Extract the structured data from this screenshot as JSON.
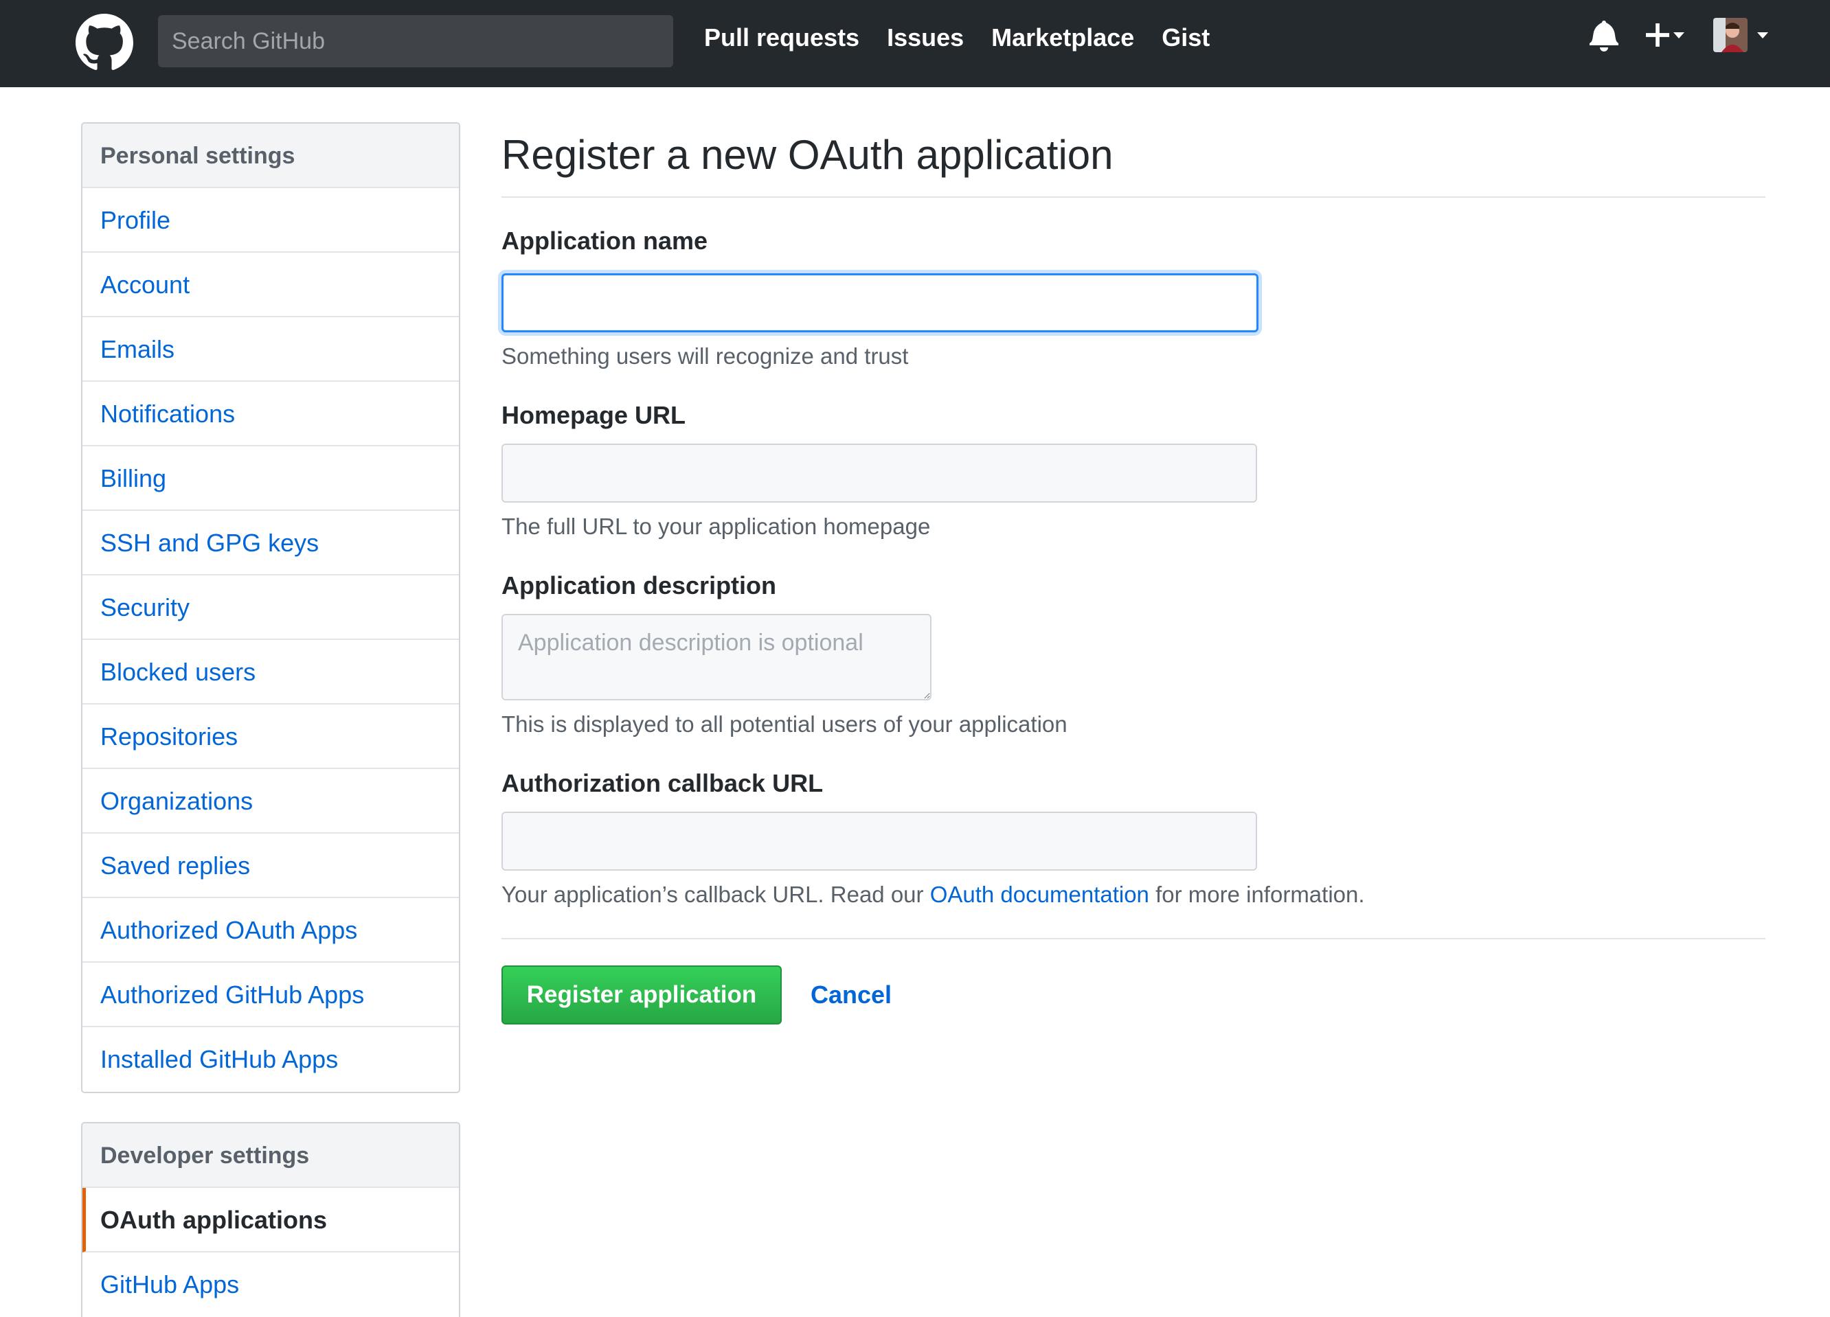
{
  "header": {
    "search_placeholder": "Search GitHub",
    "nav": [
      {
        "label": "Pull requests"
      },
      {
        "label": "Issues"
      },
      {
        "label": "Marketplace"
      },
      {
        "label": "Gist"
      }
    ],
    "icons": [
      "github-logo-icon",
      "bell-icon",
      "plus-icon",
      "chevron-down-icon",
      "avatar"
    ]
  },
  "sidebar": {
    "personal_heading": "Personal settings",
    "personal_items": [
      {
        "label": "Profile"
      },
      {
        "label": "Account"
      },
      {
        "label": "Emails"
      },
      {
        "label": "Notifications"
      },
      {
        "label": "Billing"
      },
      {
        "label": "SSH and GPG keys"
      },
      {
        "label": "Security"
      },
      {
        "label": "Blocked users"
      },
      {
        "label": "Repositories"
      },
      {
        "label": "Organizations"
      },
      {
        "label": "Saved replies"
      },
      {
        "label": "Authorized OAuth Apps"
      },
      {
        "label": "Authorized GitHub Apps"
      },
      {
        "label": "Installed GitHub Apps"
      }
    ],
    "developer_heading": "Developer settings",
    "developer_items": [
      {
        "label": "OAuth applications",
        "selected": true
      },
      {
        "label": "GitHub Apps"
      }
    ]
  },
  "main": {
    "title": "Register a new OAuth application",
    "app_name": {
      "label": "Application name",
      "value": "",
      "note": "Something users will recognize and trust"
    },
    "homepage": {
      "label": "Homepage URL",
      "value": "",
      "note": "The full URL to your application homepage"
    },
    "description": {
      "label": "Application description",
      "placeholder": "Application description is optional",
      "note": "This is displayed to all potential users of your application"
    },
    "callback": {
      "label": "Authorization callback URL",
      "value": "",
      "note_before": "Your application’s callback URL. Read our ",
      "note_link": "OAuth documentation",
      "note_after": " for more information."
    },
    "register_button": "Register application",
    "cancel_link": "Cancel"
  },
  "colors": {
    "header_bg": "#24292e",
    "link": "#0366d6",
    "primary_button": "#28a745",
    "selected_accent": "#e36209",
    "focus_ring": "#2188ff"
  }
}
